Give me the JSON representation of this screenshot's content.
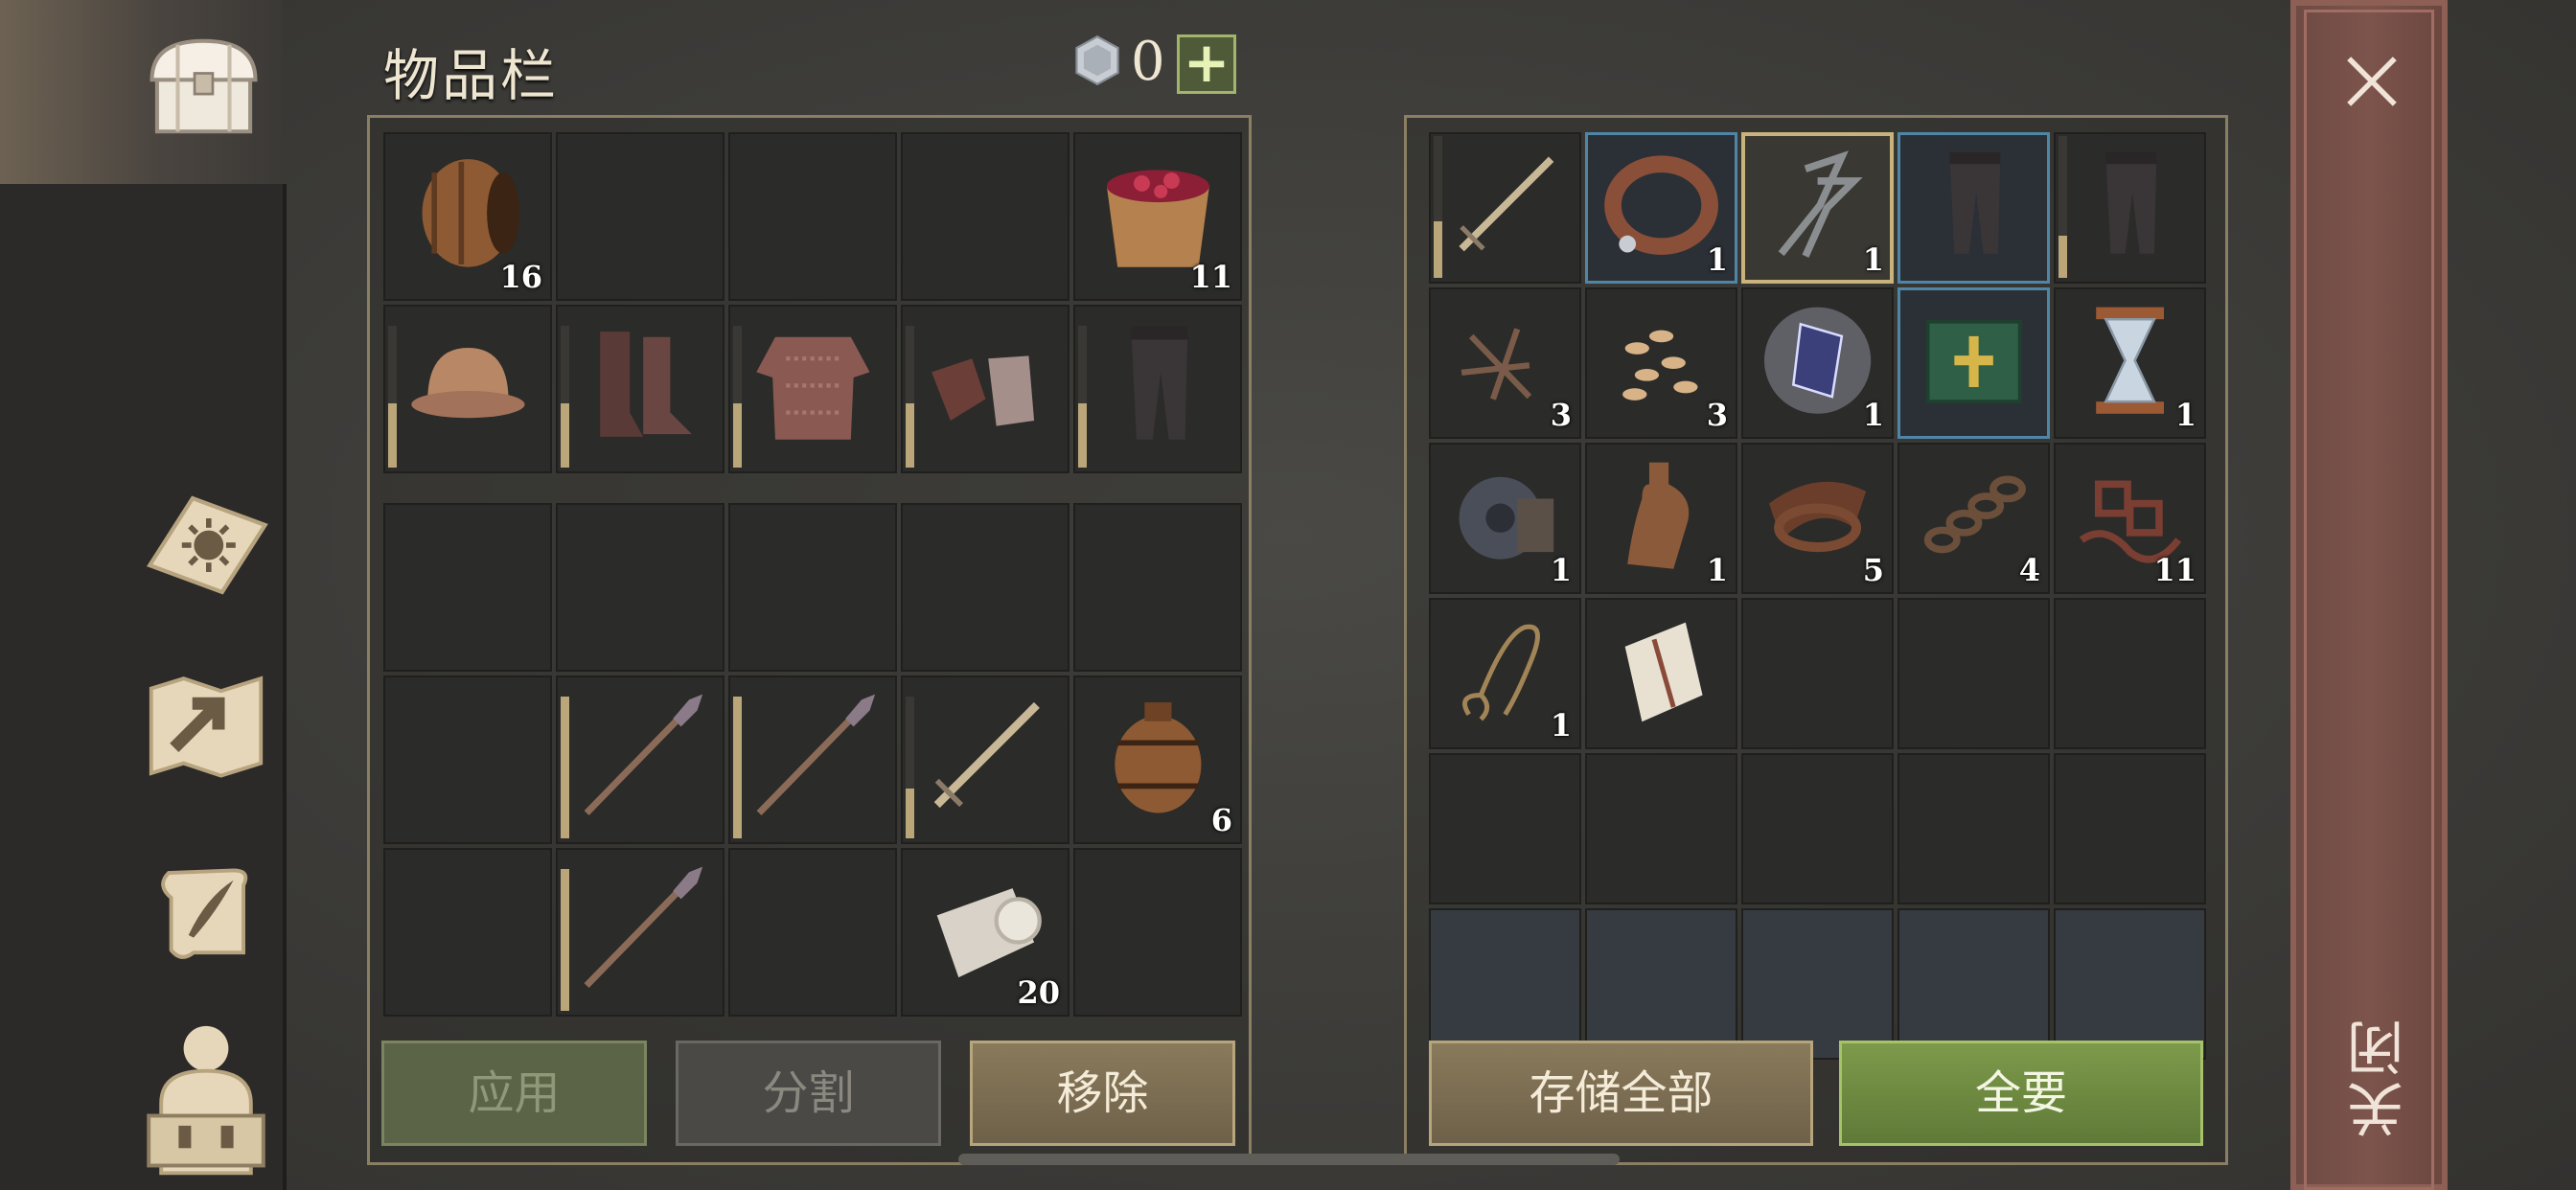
{
  "header": {
    "title": "物品栏",
    "currency_value": "0",
    "plus_symbol": "+"
  },
  "nav": {
    "items": [
      "chest-icon",
      "sun-book-icon",
      "map-icon",
      "scroll-quill-icon",
      "backpack-icon"
    ]
  },
  "inventory": {
    "equipped_rows": [
      [
        {
          "icon": "barrel",
          "count": "16"
        },
        {},
        {},
        {},
        {
          "icon": "berry-bucket",
          "count": "11"
        }
      ],
      [
        {
          "icon": "helmet",
          "durability": 0.45
        },
        {
          "icon": "boots",
          "durability": 0.45
        },
        {
          "icon": "chainmail",
          "durability": 0.45
        },
        {
          "icon": "gloves",
          "durability": 0.45
        },
        {
          "icon": "leggings",
          "durability": 0.45
        }
      ]
    ],
    "bag_rows": [
      [
        {},
        {},
        {},
        {},
        {}
      ],
      [
        {},
        {
          "icon": "spear",
          "durability": 1.0
        },
        {
          "icon": "spear",
          "durability": 1.0
        },
        {
          "icon": "sword",
          "durability": 0.35
        },
        {
          "icon": "small-barrel",
          "count": "6"
        }
      ],
      [
        {},
        {
          "icon": "spear",
          "durability": 1.0
        },
        {},
        {
          "icon": "cloth-roll",
          "count": "20"
        },
        {}
      ]
    ]
  },
  "storage": {
    "rows": [
      [
        {
          "icon": "sword",
          "durability": 0.4
        },
        {
          "icon": "collar",
          "count": "1",
          "hl": "blue"
        },
        {
          "icon": "pincers",
          "count": "1",
          "hl": "gold"
        },
        {
          "icon": "leggings",
          "hl": "blue"
        },
        {
          "icon": "leggings",
          "durability": 0.3
        }
      ],
      [
        {
          "icon": "nails",
          "count": "3"
        },
        {
          "icon": "seeds",
          "count": "3"
        },
        {
          "icon": "crystal",
          "count": "1"
        },
        {
          "icon": "green-book",
          "hl": "blue"
        },
        {
          "icon": "hourglass",
          "count": "1"
        }
      ],
      [
        {
          "icon": "gear",
          "count": "1"
        },
        {
          "icon": "bottle",
          "count": "1"
        },
        {
          "icon": "leather",
          "count": "5"
        },
        {
          "icon": "chain",
          "count": "4"
        },
        {
          "icon": "scraps",
          "count": "11"
        }
      ],
      [
        {
          "icon": "rope",
          "count": "1"
        },
        {
          "icon": "scroll"
        },
        {},
        {},
        {}
      ],
      [
        {},
        {},
        {},
        {},
        {}
      ],
      [
        {
          "dim": true
        },
        {
          "dim": true
        },
        {
          "dim": true
        },
        {
          "dim": true
        },
        {
          "dim": true
        }
      ]
    ]
  },
  "buttons": {
    "apply": "应用",
    "split": "分割",
    "remove": "移除",
    "store_all": "存储全部",
    "take_all": "全要"
  },
  "close_label": "关闭"
}
